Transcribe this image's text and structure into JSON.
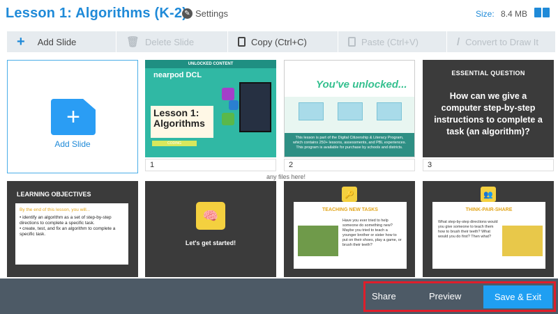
{
  "header": {
    "title": "Lesson 1: Algorithms (K-2)",
    "settings_label": "Settings",
    "size_label": "Size:",
    "size_value": "8.4 MB"
  },
  "toolbar": {
    "add_slide": "Add Slide",
    "delete_slide": "Delete Slide",
    "copy": "Copy (Ctrl+C)",
    "paste": "Paste (Ctrl+V)",
    "convert": "Convert to Draw It"
  },
  "add_tile": {
    "label": "Add Slide"
  },
  "slides": [
    {
      "number": "1",
      "banner": "UNLOCKED CONTENT",
      "logo": "nearpod DCL",
      "title": "Lesson 1: Algorithms",
      "tag": "CODING"
    },
    {
      "number": "2",
      "heading": "You've unlocked...",
      "body": "This lesson is part of the Digital Citizenship & Literacy Program, which contains 250+ lessons, assessments, and PBL experiences. This program is available for purchase by schools and districts."
    },
    {
      "number": "3",
      "heading": "ESSENTIAL QUESTION",
      "question": "How can we give a computer step-by-step instructions to complete a task (an algorithm)?"
    },
    {
      "heading": "LEARNING OBJECTIVES",
      "intro": "By the end of this lesson, you will...",
      "bullet1": "• identify an algorithm as a set of step-by-step directions to complete a specific task.",
      "bullet2": "• create, test, and fix an algorithm to complete a specific task."
    },
    {
      "caption": "Let's get started!"
    },
    {
      "heading": "TEACHING NEW TASKS",
      "body": "Have you ever tried to help someone do something new? Maybe you tried to teach a younger brother or sister how to put on their shoes, play a game, or brush their teeth?"
    },
    {
      "heading": "THINK-PAIR-SHARE",
      "body": "What step-by-step directions would you give someone to teach them how to brush their teeth? What would you do first? Then what?"
    }
  ],
  "drop_hint": "any files here!",
  "footer": {
    "share": "Share",
    "preview": "Preview",
    "save_exit": "Save & Exit"
  },
  "colors": {
    "accent": "#1f9ff2",
    "footer_bg": "#4d5a66",
    "highlight_border": "#e01e2b"
  }
}
